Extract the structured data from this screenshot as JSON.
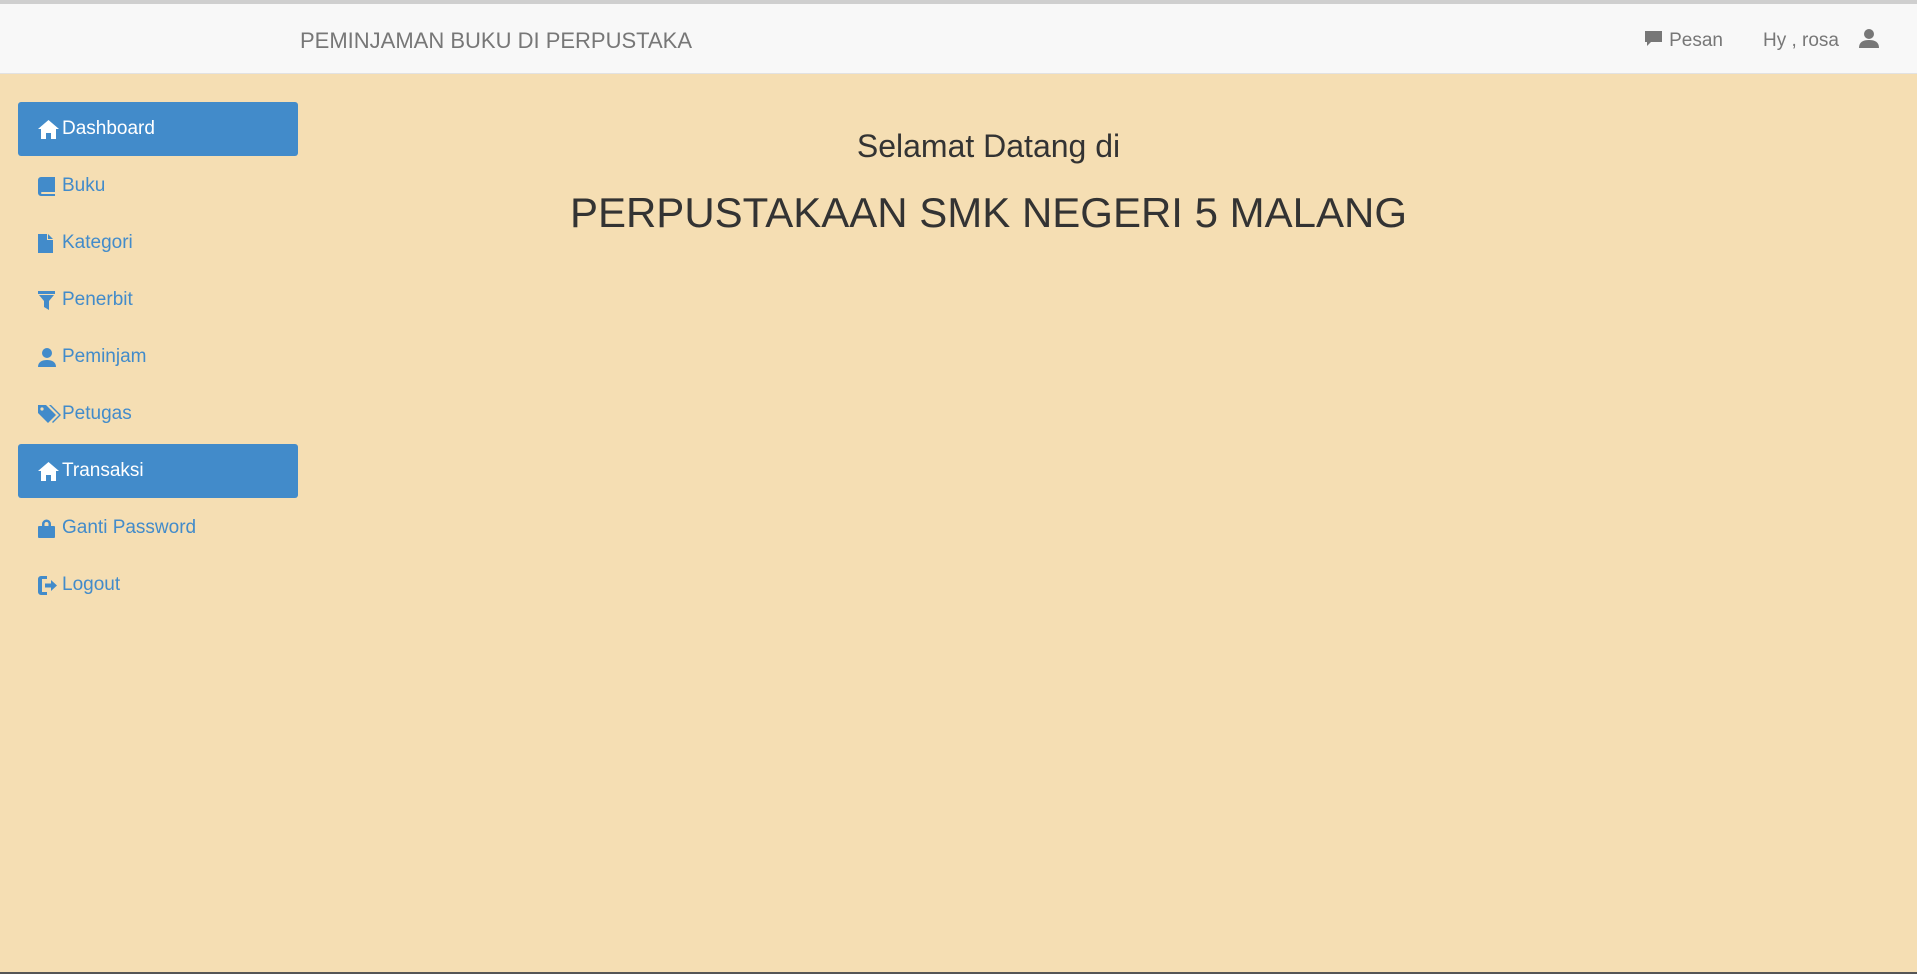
{
  "navbar": {
    "brand": "PEMINJAMAN BUKU DI PERPUSTAKAAN",
    "messages_label": "Pesan",
    "user_greeting": "Hy , rosa"
  },
  "sidebar": {
    "items": [
      {
        "label": "Dashboard",
        "icon": "home-icon",
        "active": true
      },
      {
        "label": "Buku",
        "icon": "book-icon",
        "active": false
      },
      {
        "label": "Kategori",
        "icon": "file-icon",
        "active": false
      },
      {
        "label": "Penerbit",
        "icon": "filter-icon",
        "active": false
      },
      {
        "label": "Peminjam",
        "icon": "user-icon",
        "active": false
      },
      {
        "label": "Petugas",
        "icon": "tags-icon",
        "active": false
      },
      {
        "label": "Transaksi",
        "icon": "home-icon",
        "active": true
      },
      {
        "label": "Ganti Password",
        "icon": "lock-icon",
        "active": false
      },
      {
        "label": "Logout",
        "icon": "logout-icon",
        "active": false
      }
    ]
  },
  "main": {
    "welcome": "Selamat Datang di",
    "school": "PERPUSTAKAAN SMK NEGERI 5 MALANG"
  },
  "colors": {
    "background": "#f5deb3",
    "accent": "#428bca",
    "navbar": "#f8f8f8"
  }
}
